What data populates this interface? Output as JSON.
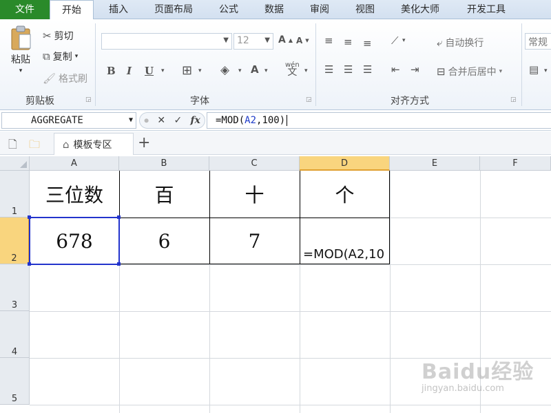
{
  "ribbon_tabs": [
    "文件",
    "开始",
    "插入",
    "页面布局",
    "公式",
    "数据",
    "审阅",
    "视图",
    "美化大师",
    "开发工具"
  ],
  "clipboard": {
    "paste_label": "粘贴",
    "cut_label": "剪切",
    "copy_label": "复制",
    "format_painter_label": "格式刷",
    "group_title": "剪贴板"
  },
  "font": {
    "font_name": "",
    "font_size": "12",
    "bold": "B",
    "italic": "I",
    "underline": "U",
    "group_title": "字体",
    "wen": "wén"
  },
  "alignment": {
    "wrap_text_label": "自动换行",
    "merge_center_label": "合并后居中",
    "group_title": "对齐方式"
  },
  "number": {
    "format_label": "常规"
  },
  "formula_bar": {
    "name_box": "AGGREGATE",
    "formula_prefix": "=MOD(",
    "formula_ref": "A2",
    "formula_suffix": ",100)",
    "fx": "fx"
  },
  "doc_tabs": {
    "template_tab": "模板专区"
  },
  "columns": [
    "A",
    "B",
    "C",
    "D",
    "E",
    "F"
  ],
  "rows": [
    "1",
    "2",
    "3",
    "4",
    "5"
  ],
  "cells": {
    "A1": "三位数",
    "B1": "百",
    "C1": "十",
    "D1": "个",
    "A2": "678",
    "B2": "6",
    "C2": "7",
    "D2": "=MOD(A2,10"
  },
  "watermark": {
    "logo": "Baidu经验",
    "url": "jingyan.baidu.com"
  },
  "colors": {
    "file_tab": "#2a8a2a",
    "selection": "#2233cc",
    "header_selected": "#f9d57e",
    "formula_ref": "#1d3bc9"
  }
}
